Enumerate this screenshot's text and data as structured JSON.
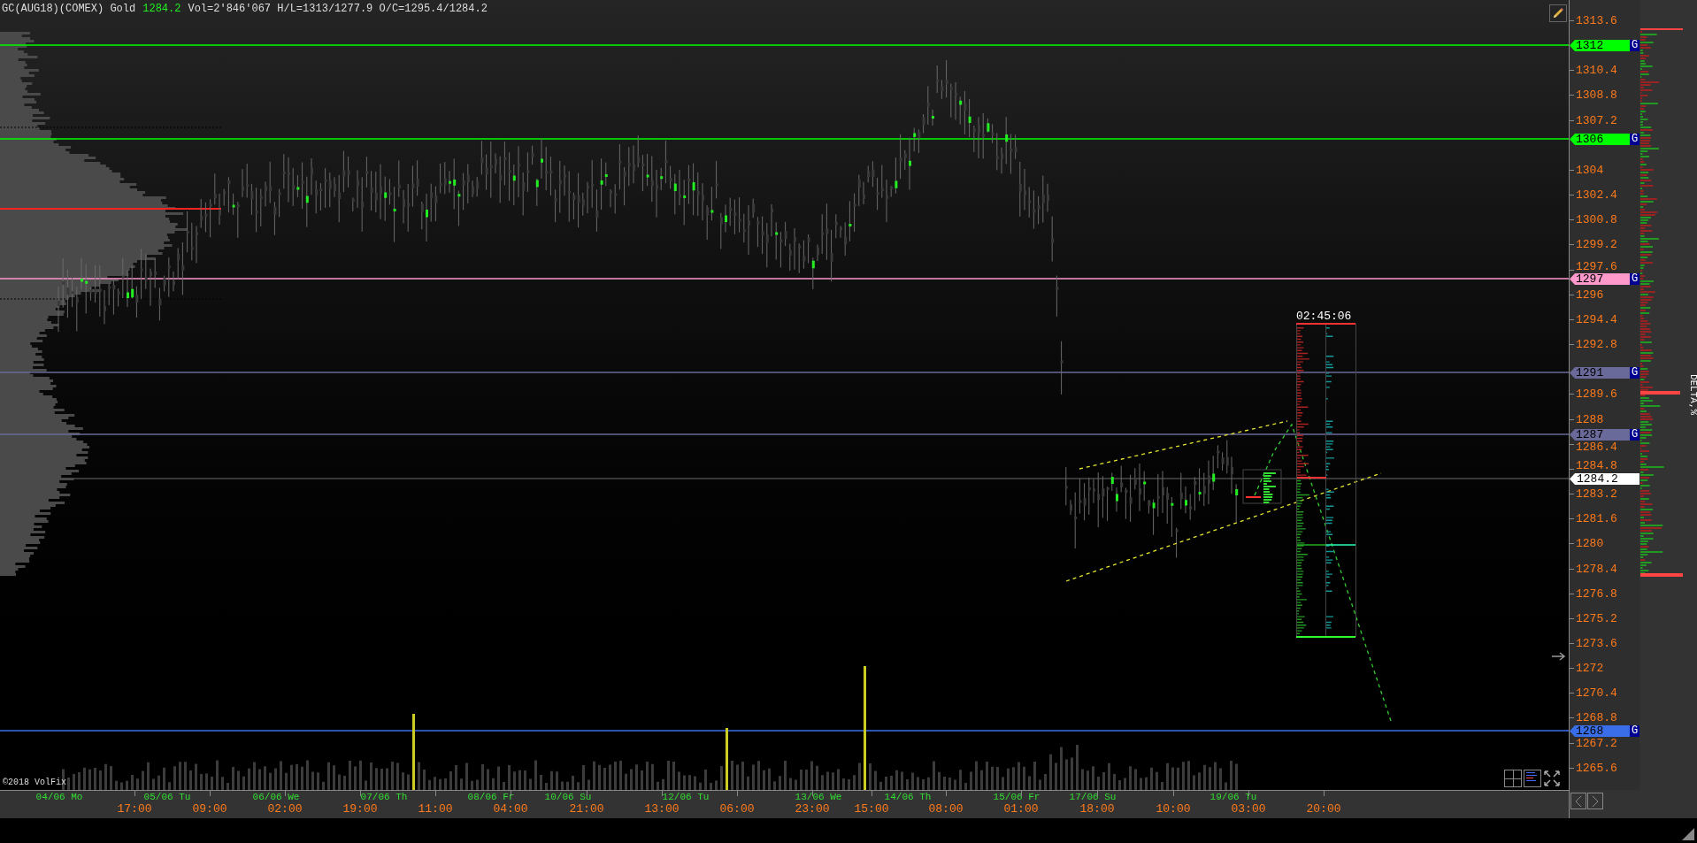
{
  "header": {
    "instrument": "GC(AUG18)(COMEX) Gold",
    "last_price": "1284.2",
    "stats": "Vol=2'846'067 H/L=1313/1277.9 O/C=1295.4/1284.2"
  },
  "price_axis": {
    "ticks": [
      "1313.6",
      "1310.4",
      "1308.8",
      "1307.2",
      "1304",
      "1302.4",
      "1300.8",
      "1299.2",
      "1297.6",
      "1296",
      "1294.4",
      "1292.8",
      "1289.6",
      "1288",
      "1286.4",
      "1284.8",
      "1283.2",
      "1281.6",
      "1280",
      "1278.4",
      "1276.8",
      "1275.2",
      "1273.6",
      "1272",
      "1270.4",
      "1268.8",
      "1267.2",
      "1265.6"
    ]
  },
  "levels": [
    {
      "kind": "level",
      "label": "1312",
      "color": "#00ff00",
      "badge": "G"
    },
    {
      "kind": "level",
      "label": "1306",
      "color": "#00ff00",
      "badge": "G"
    },
    {
      "kind": "level",
      "label": "1297",
      "color": "#ff99cc",
      "badge": "G"
    },
    {
      "kind": "level",
      "label": "1291",
      "color": "#6a6a9a",
      "badge": "G"
    },
    {
      "kind": "level",
      "label": "1287",
      "color": "#6a6a9a",
      "badge": "G"
    },
    {
      "kind": "last",
      "label": "1284.2",
      "color": "#ffffff"
    },
    {
      "kind": "level",
      "label": "1268",
      "color": "#3a6ee8",
      "badge": "G"
    }
  ],
  "countdown": "02:45:06",
  "time_axis": {
    "dates": [
      "04/06 Mo",
      "05/06 Tu",
      "06/06 We",
      "07/06 Th",
      "08/06 Fr",
      "10/06 Su",
      "12/06 Tu",
      "13/06 We",
      "14/06 Th",
      "15/06 Fr",
      "17/06 Su",
      "19/06 Tu"
    ],
    "times": [
      "17:00",
      "09:00",
      "02:00",
      "19:00",
      "11:00",
      "04:00",
      "21:00",
      "13:00",
      "06:00",
      "23:00",
      "15:00",
      "08:00",
      "01:00",
      "18:00",
      "10:00",
      "03:00",
      "20:00"
    ]
  },
  "copyright": "©2018 VolFix",
  "side_panel": {
    "title": "DELTA,%"
  }
}
